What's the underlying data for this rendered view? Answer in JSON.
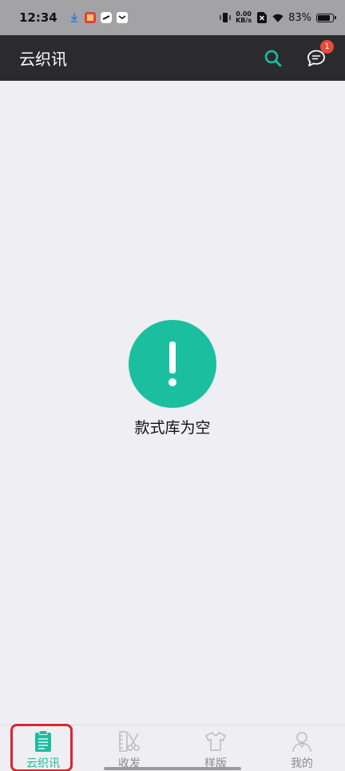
{
  "status_bar": {
    "time": "12:34",
    "net_speed_value": "0.00",
    "net_speed_unit": "KB/s",
    "battery_percent": "83%",
    "battery_level": 0.83
  },
  "app_bar": {
    "title": "云织讯",
    "search_icon": "search-icon",
    "message_icon": "chat-bubble-icon",
    "message_badge": "1",
    "accent_color": "#1bbf9f"
  },
  "empty_state": {
    "icon_symbol": "!",
    "message": "款式库为空"
  },
  "bottom_nav": {
    "items": [
      {
        "label": "云织讯",
        "icon": "clipboard-icon",
        "active": true
      },
      {
        "label": "收发",
        "icon": "scissors-ruler-icon",
        "active": false
      },
      {
        "label": "样版",
        "icon": "shirt-icon",
        "active": false
      },
      {
        "label": "我的",
        "icon": "person-icon",
        "active": false
      }
    ]
  }
}
